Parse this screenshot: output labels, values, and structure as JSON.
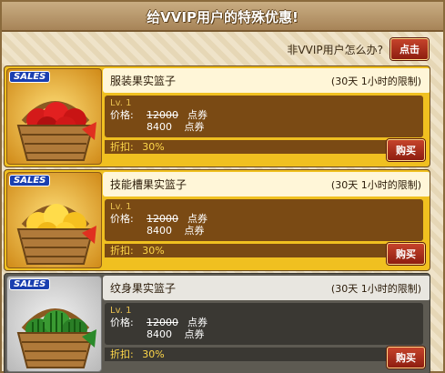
{
  "header": {
    "title": "给VVIP用户的特殊优惠!"
  },
  "question": {
    "text": "非VVIP用户怎么办?",
    "button": "点击"
  },
  "items": [
    {
      "badge": "SALES",
      "name": "服装果实篮子",
      "limit": "(30天 1小时的限制)",
      "level": "Lv. 1",
      "price_label": "价格:",
      "old_price": "12000",
      "new_price": "8400",
      "unit": "点券",
      "discount_label": "折扣:",
      "discount": "30%",
      "buy": "购买",
      "fruit": "apple"
    },
    {
      "badge": "SALES",
      "name": "技能槽果实篮子",
      "limit": "(30天 1小时的限制)",
      "level": "Lv. 1",
      "price_label": "价格:",
      "old_price": "12000",
      "new_price": "8400",
      "unit": "点券",
      "discount_label": "折扣:",
      "discount": "30%",
      "buy": "购买",
      "fruit": "orange"
    },
    {
      "badge": "SALES",
      "name": "纹身果实篮子",
      "limit": "(30天 1小时的限制)",
      "level": "Lv. 1",
      "price_label": "价格:",
      "old_price": "12000",
      "new_price": "8400",
      "unit": "点券",
      "discount_label": "折扣:",
      "discount": "30%",
      "buy": "购买",
      "fruit": "watermelon"
    }
  ],
  "colors": {
    "gold_card": "#f0c020",
    "gray_card": "#5d5a52",
    "button_red": "#a8301c",
    "discount_yellow": "#ffd84a"
  }
}
